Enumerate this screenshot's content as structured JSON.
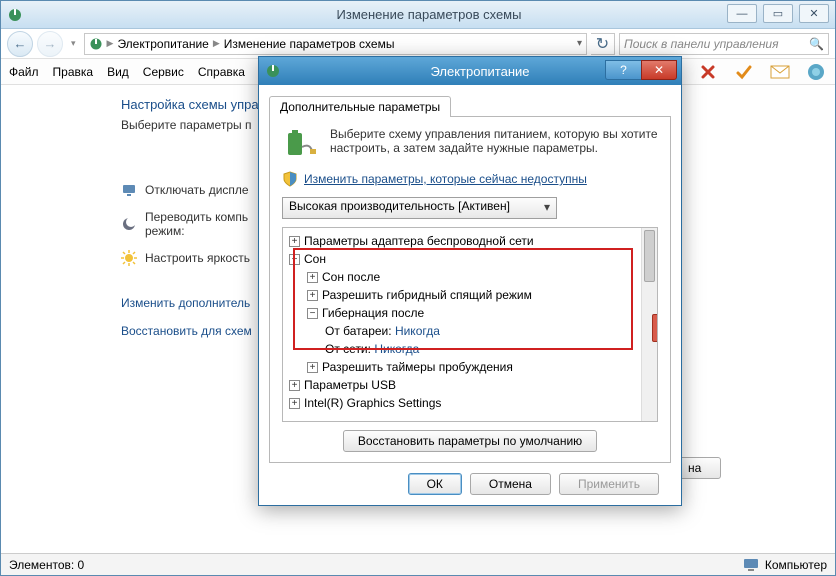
{
  "window": {
    "title": "Изменение параметров схемы",
    "min": "—",
    "max": "▭",
    "close": "✕"
  },
  "nav": {
    "back": "←",
    "fwd": "→",
    "up": "▾",
    "bc1": "Электропитание",
    "bc2": "Изменение параметров схемы",
    "refresh": "↻",
    "search_ph": "Поиск в панели управления",
    "mag": "🔍"
  },
  "menu": {
    "file": "Файл",
    "edit": "Правка",
    "view": "Вид",
    "service": "Сервис",
    "help": "Справка"
  },
  "bg": {
    "heading": "Настройка схемы управ",
    "subhead": "Выберите параметры п",
    "row1": "Отключать диспле",
    "row2a": "Переводить компь",
    "row2b": "режим:",
    "row3": "Настроить яркость",
    "link1": "Изменить дополнитель",
    "link2": "Восстановить для схем",
    "btn_partial": "на"
  },
  "dialog": {
    "title": "Электропитание",
    "help": "?",
    "close": "✕",
    "tab": "Дополнительные параметры",
    "desc": "Выберите схему управления питанием, которую вы хотите настроить, а затем задайте нужные параметры.",
    "shield_link": "Изменить параметры, которые сейчас недоступны",
    "plan": "Высокая производительность [Активен]",
    "restore": "Восстановить параметры по умолчанию",
    "ok": "ОК",
    "cancel": "Отмена",
    "apply": "Применить"
  },
  "tree": {
    "n0": "Параметры адаптера беспроводной сети",
    "n1": "Сон",
    "n1a": "Сон после",
    "n1b": "Разрешить гибридный спящий режим",
    "n1c": "Гибернация после",
    "n1c1_l": "От батареи:",
    "n1c1_v": "Никогда",
    "n1c2_l": "От сети:",
    "n1c2_v": "Никогда",
    "n1d": "Разрешить таймеры пробуждения",
    "n2": "Параметры USB",
    "n3": "Intel(R) Graphics Settings"
  },
  "status": {
    "left": "Элементов: 0",
    "right": "Компьютер"
  }
}
